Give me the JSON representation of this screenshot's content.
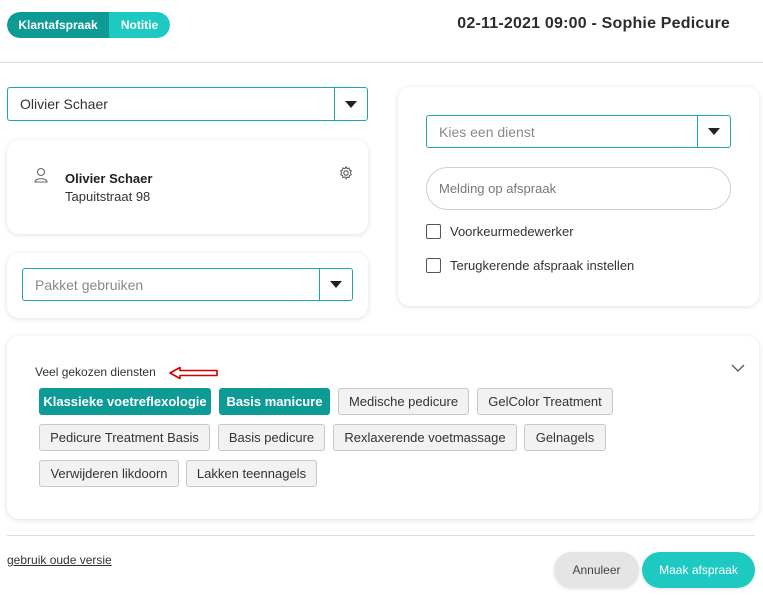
{
  "header": {
    "tabs": [
      {
        "label": "Klantafspraak",
        "active": true
      },
      {
        "label": "Notitie",
        "active": false
      }
    ],
    "title": "02-11-2021 09:00 - Sophie Pedicure"
  },
  "client": {
    "select_value": "Olivier Schaer",
    "name": "Olivier Schaer",
    "address": "Tapuitstraat 98"
  },
  "package": {
    "placeholder": "Pakket gebruiken"
  },
  "service": {
    "placeholder": "Kies een dienst",
    "note_placeholder": "Melding op afspraak",
    "checkboxes": [
      {
        "label": "Voorkeurmedewerker",
        "checked": false
      },
      {
        "label": "Terugkerende afspraak instellen",
        "checked": false
      }
    ]
  },
  "popular": {
    "label": "Veel gekozen diensten",
    "chips": [
      {
        "label": "Klassieke voetreflexologie",
        "active": true
      },
      {
        "label": "Basis manicure",
        "active": true
      },
      {
        "label": "Medische pedicure",
        "active": false
      },
      {
        "label": "GelColor Treatment",
        "active": false
      },
      {
        "label": "Pedicure Treatment Basis",
        "active": false
      },
      {
        "label": "Basis pedicure",
        "active": false
      },
      {
        "label": "Rexlaxerende voetmassage",
        "active": false
      },
      {
        "label": "Gelnagels",
        "active": false
      },
      {
        "label": "Verwijderen likdoorn",
        "active": false
      },
      {
        "label": "Lakken teennagels",
        "active": false
      }
    ]
  },
  "footer": {
    "old_version_link": "gebruik oude versie",
    "cancel_label": "Annuleer",
    "submit_label": "Maak afspraak"
  },
  "colors": {
    "accent": "#0e9a95",
    "accent_light": "#1ec9c2",
    "annotation_arrow": "#d00000"
  }
}
